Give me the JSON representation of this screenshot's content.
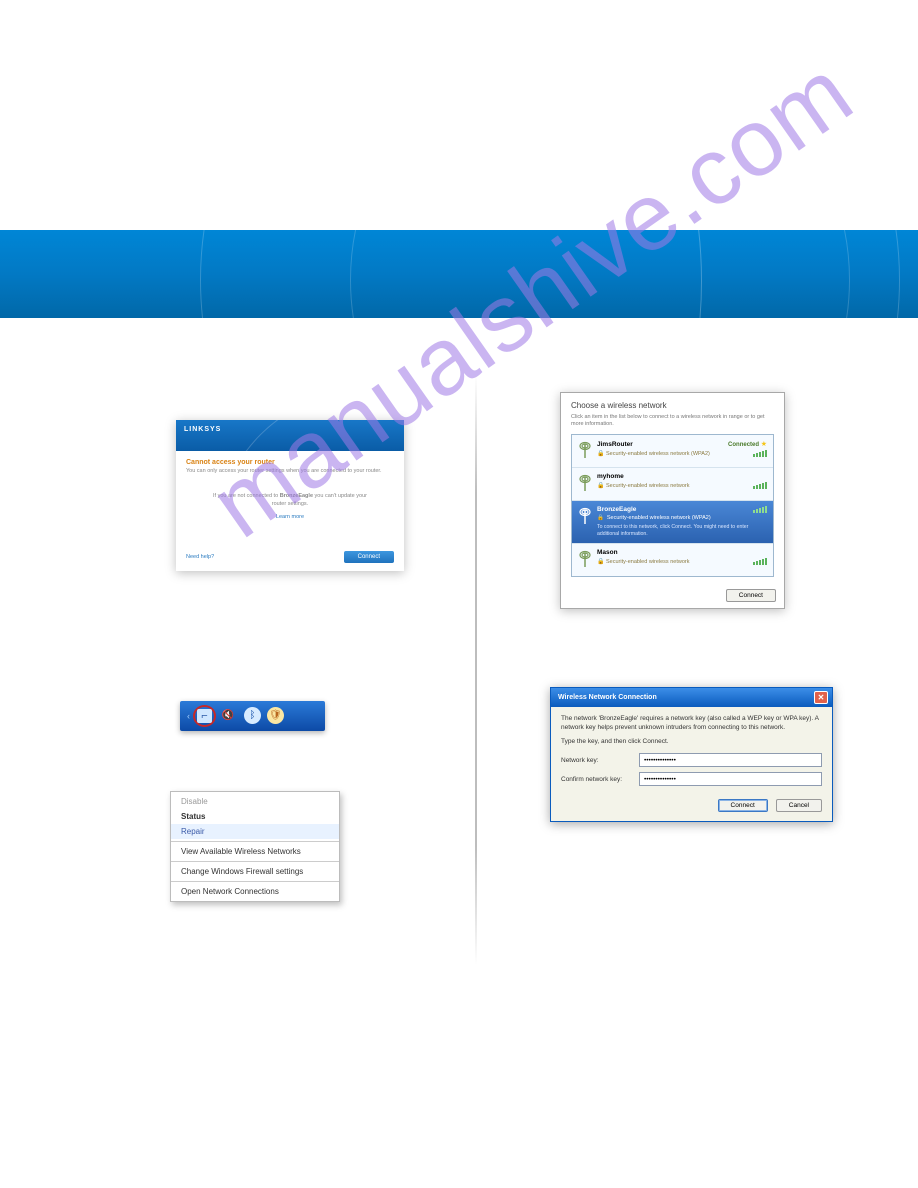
{
  "watermark": "manualshive.com",
  "linksys": {
    "brand": "LINKSYS",
    "title": "Cannot access your router",
    "subtitle": "You can only access your router settings when you are connected to your router.",
    "msg_before": "If you are not connected to",
    "msg_net": "BronzeEagle",
    "msg_after": "you can't update your router settings.",
    "learn_more": "Learn more",
    "help": "Need help?",
    "btn": "Connect"
  },
  "ctx": {
    "disable": "Disable",
    "status": "Status",
    "repair": "Repair",
    "view": "View Available Wireless Networks",
    "firewall": "Change Windows Firewall settings",
    "open": "Open Network Connections"
  },
  "wl": {
    "title": "Choose a wireless network",
    "sub": "Click an item in the list below to connect to a wireless network in range or to get more information.",
    "connect_btn": "Connect",
    "items": [
      {
        "name": "JimsRouter",
        "sec": "Security-enabled wireless network (WPA2)",
        "status": "Connected"
      },
      {
        "name": "myhome",
        "sec": "Security-enabled wireless network"
      },
      {
        "name": "BronzeEagle",
        "sec": "Security-enabled wireless network (WPA2)",
        "note": "To connect to this network, click Connect. You might need to enter additional information."
      },
      {
        "name": "Mason",
        "sec": "Security-enabled wireless network"
      }
    ]
  },
  "key": {
    "titlebar": "Wireless Network Connection",
    "desc": "The network 'BronzeEagle' requires a network key (also called a WEP key or WPA key). A network key helps prevent unknown intruders from connecting to this network.",
    "prompt": "Type the key, and then click Connect.",
    "label_key": "Network key:",
    "label_confirm": "Confirm network key:",
    "value": "••••••••••••••",
    "connect": "Connect",
    "cancel": "Cancel"
  }
}
